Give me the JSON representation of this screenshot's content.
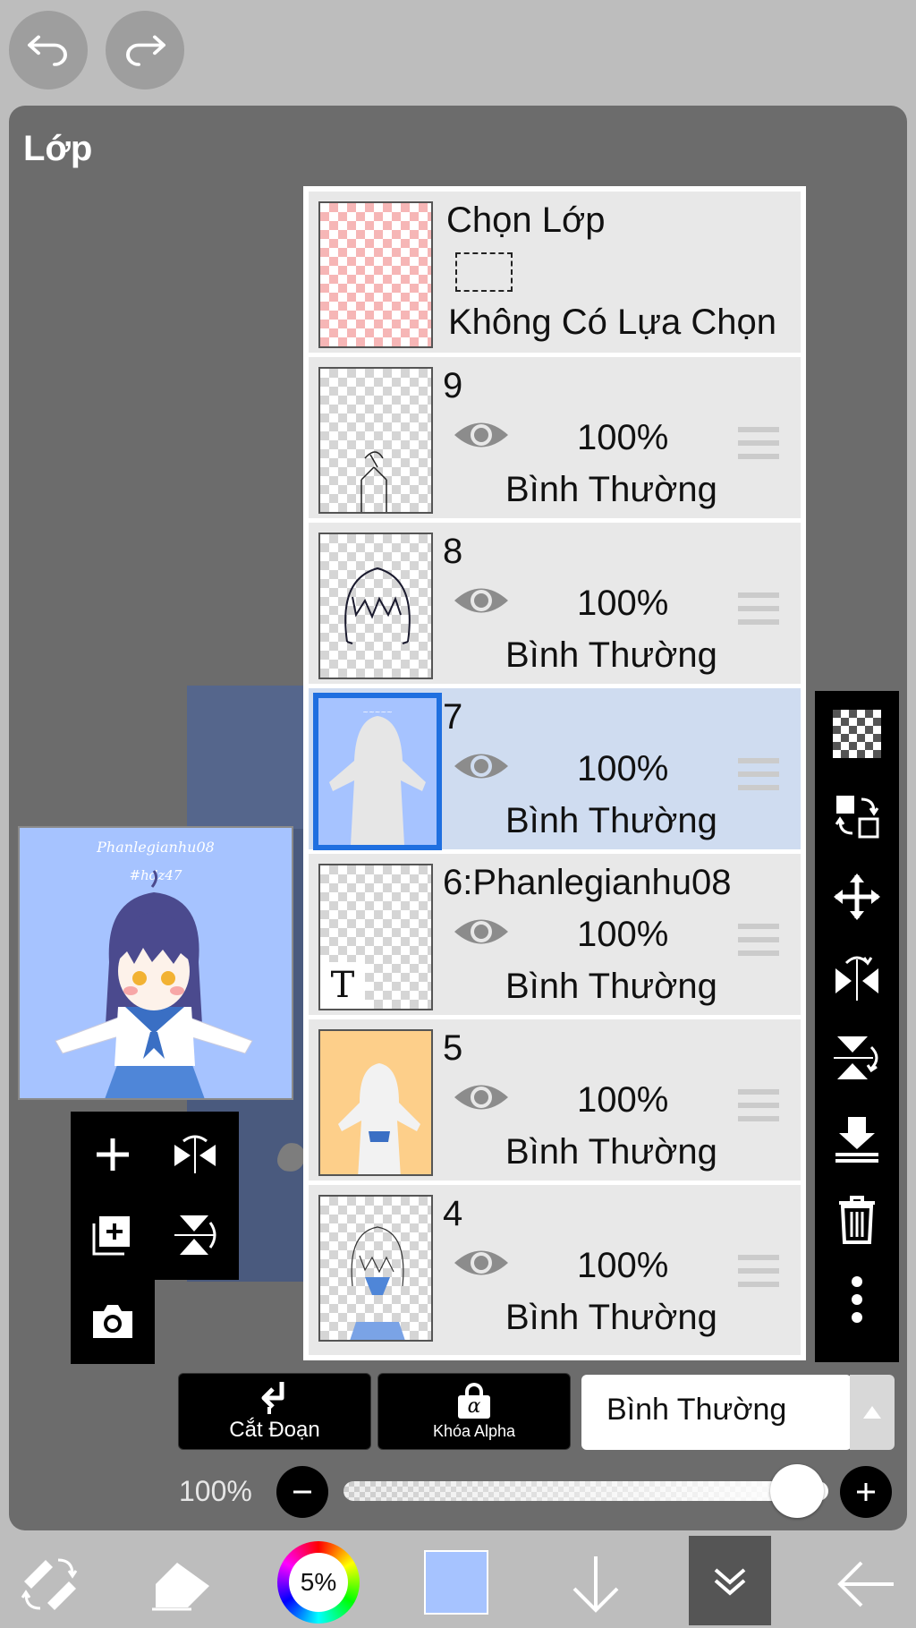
{
  "panel": {
    "title": "Lớp"
  },
  "preview": {
    "title_text": "Phanlegianhu08",
    "hashtag": "#hdz47"
  },
  "selection_layer": {
    "title": "Chọn Lớp",
    "status": "Không Có Lựa Chọn"
  },
  "layers": [
    {
      "name": "9",
      "opacity": "100%",
      "blend": "Bình Thường",
      "selected": false
    },
    {
      "name": "8",
      "opacity": "100%",
      "blend": "Bình Thường",
      "selected": false
    },
    {
      "name": "7",
      "opacity": "100%",
      "blend": "Bình Thường",
      "selected": true
    },
    {
      "name": "6:Phanlegianhu08",
      "opacity": "100%",
      "blend": "Bình Thường",
      "selected": false
    },
    {
      "name": "5",
      "opacity": "100%",
      "blend": "Bình Thường",
      "selected": false
    },
    {
      "name": "4",
      "opacity": "100%",
      "blend": "Bình Thường",
      "selected": false
    }
  ],
  "text_layer_marker": "T",
  "toolbar": {
    "clip_label": "Cắt Đoạn",
    "alpha_lock_label": "Khóa Alpha",
    "alpha_symbol": "α",
    "blend_mode": "Bình Thường"
  },
  "opacity": {
    "label": "100%",
    "value": 1.0
  },
  "bottom": {
    "brush_size": "5%",
    "color": "#a6c3ff"
  },
  "colors": {
    "selected_border": "#1f6fe0",
    "selected_row": "#cfdcf0",
    "panel": "#6c6c6c"
  }
}
